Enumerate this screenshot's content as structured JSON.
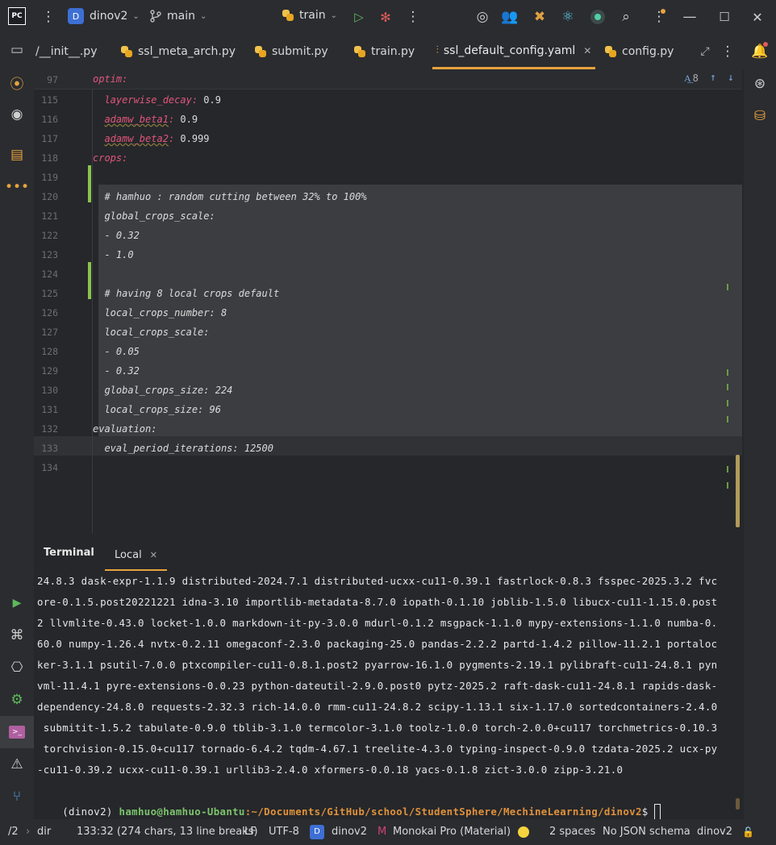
{
  "titlebar": {
    "project_badge": "D",
    "project_name": "dinov2",
    "branch": "main",
    "run_config": "train",
    "app_badge": "PC"
  },
  "tabs": [
    {
      "label": "/__init__.py"
    },
    {
      "label": "ssl_meta_arch.py"
    },
    {
      "label": "submit.py"
    },
    {
      "label": "train.py"
    },
    {
      "label": "ssl_default_config.yaml",
      "active": true
    },
    {
      "label": "config.py"
    }
  ],
  "editor": {
    "sticky_line": {
      "num": "97",
      "text": "optim:"
    },
    "search_count": "8",
    "lines": [
      {
        "num": "115",
        "indent": "  ",
        "key": "layerwise_decay",
        "value": " 0.9"
      },
      {
        "num": "116",
        "indent": "  ",
        "key": "adamw_beta1",
        "value": " 0.9"
      },
      {
        "num": "117",
        "indent": "  ",
        "key": "adamw_beta2",
        "value": " 0.999"
      },
      {
        "num": "118",
        "indent": "",
        "key": "crops",
        "value": ""
      },
      {
        "num": "119",
        "text": ""
      },
      {
        "num": "120",
        "text": "  # hamhuo : random cutting between 32% to 100%"
      },
      {
        "num": "121",
        "text": "  global_crops_scale:"
      },
      {
        "num": "122",
        "text": "  - 0.32"
      },
      {
        "num": "123",
        "text": "  - 1.0"
      },
      {
        "num": "124",
        "text": ""
      },
      {
        "num": "125",
        "text": "  # having 8 local crops default"
      },
      {
        "num": "126",
        "text": "  local_crops_number: 8"
      },
      {
        "num": "127",
        "text": "  local_crops_scale:"
      },
      {
        "num": "128",
        "text": "  - 0.05"
      },
      {
        "num": "129",
        "text": "  - 0.32"
      },
      {
        "num": "130",
        "text": "  global_crops_size: 224"
      },
      {
        "num": "131",
        "text": "  local_crops_size: 96"
      },
      {
        "num": "132",
        "text": "evaluation:"
      },
      {
        "num": "133",
        "text": "  eval_period_iterations: 12500"
      },
      {
        "num": "134",
        "text": ""
      }
    ]
  },
  "terminal": {
    "title": "Terminal",
    "tab": "Local",
    "output_lines": [
      "24.8.3 dask-expr-1.1.9 distributed-2024.7.1 distributed-ucxx-cu11-0.39.1 fastrlock-0.8.3 fsspec-2025.3.2 fvc",
      "ore-0.1.5.post20221221 idna-3.10 importlib-metadata-8.7.0 iopath-0.1.10 joblib-1.5.0 libucx-cu11-1.15.0.post",
      "2 llvmlite-0.43.0 locket-1.0.0 markdown-it-py-3.0.0 mdurl-0.1.2 msgpack-1.1.0 mypy-extensions-1.1.0 numba-0.",
      "60.0 numpy-1.26.4 nvtx-0.2.11 omegaconf-2.3.0 packaging-25.0 pandas-2.2.2 partd-1.4.2 pillow-11.2.1 portaloc",
      "ker-3.1.1 psutil-7.0.0 ptxcompiler-cu11-0.8.1.post2 pyarrow-16.1.0 pygments-2.19.1 pylibraft-cu11-24.8.1 pyn",
      "vml-11.4.1 pyre-extensions-0.0.23 python-dateutil-2.9.0.post0 pytz-2025.2 raft-dask-cu11-24.8.1 rapids-dask-",
      "dependency-24.8.0 requests-2.32.3 rich-14.0.0 rmm-cu11-24.8.2 scipy-1.13.1 six-1.17.0 sortedcontainers-2.4.0",
      " submitit-1.5.2 tabulate-0.9.0 tblib-3.1.0 termcolor-3.1.0 toolz-1.0.0 torch-2.0.0+cu117 torchmetrics-0.10.3",
      " torchvision-0.15.0+cu117 tornado-6.4.2 tqdm-4.67.1 treelite-4.3.0 typing-inspect-0.9.0 tzdata-2025.2 ucx-py",
      "-cu11-0.39.2 ucxx-cu11-0.39.1 urllib3-2.4.0 xformers-0.0.18 yacs-0.1.8 zict-3.0.0 zipp-3.21.0"
    ],
    "prompt_env": "(dinov2)",
    "prompt_user": "hamhuo@hamhuo-Ubantu",
    "prompt_path": ":~/Documents/GitHub/school/StudentSphere/MechineLearning/dinov2",
    "prompt_symbol": "$"
  },
  "statusbar": {
    "breadcrumb_left": "/2",
    "breadcrumb_dir": "dir",
    "position": "133:32 (274 chars, 13 line breaks)",
    "line_ending": "LF",
    "encoding": "UTF-8",
    "interpreter_badge": "D",
    "interpreter": "dinov2",
    "theme": "Monokai Pro (Material)",
    "indent": "2 spaces",
    "schema": "No JSON schema",
    "project": "dinov2"
  },
  "colors": {
    "accent": "#e8a33d",
    "yaml_key": "#e2557a",
    "prompt_user": "#7cc36b",
    "prompt_path": "#e0913a",
    "badge_blue": "#3d6fd4",
    "green_marker": "#8bc34a"
  }
}
